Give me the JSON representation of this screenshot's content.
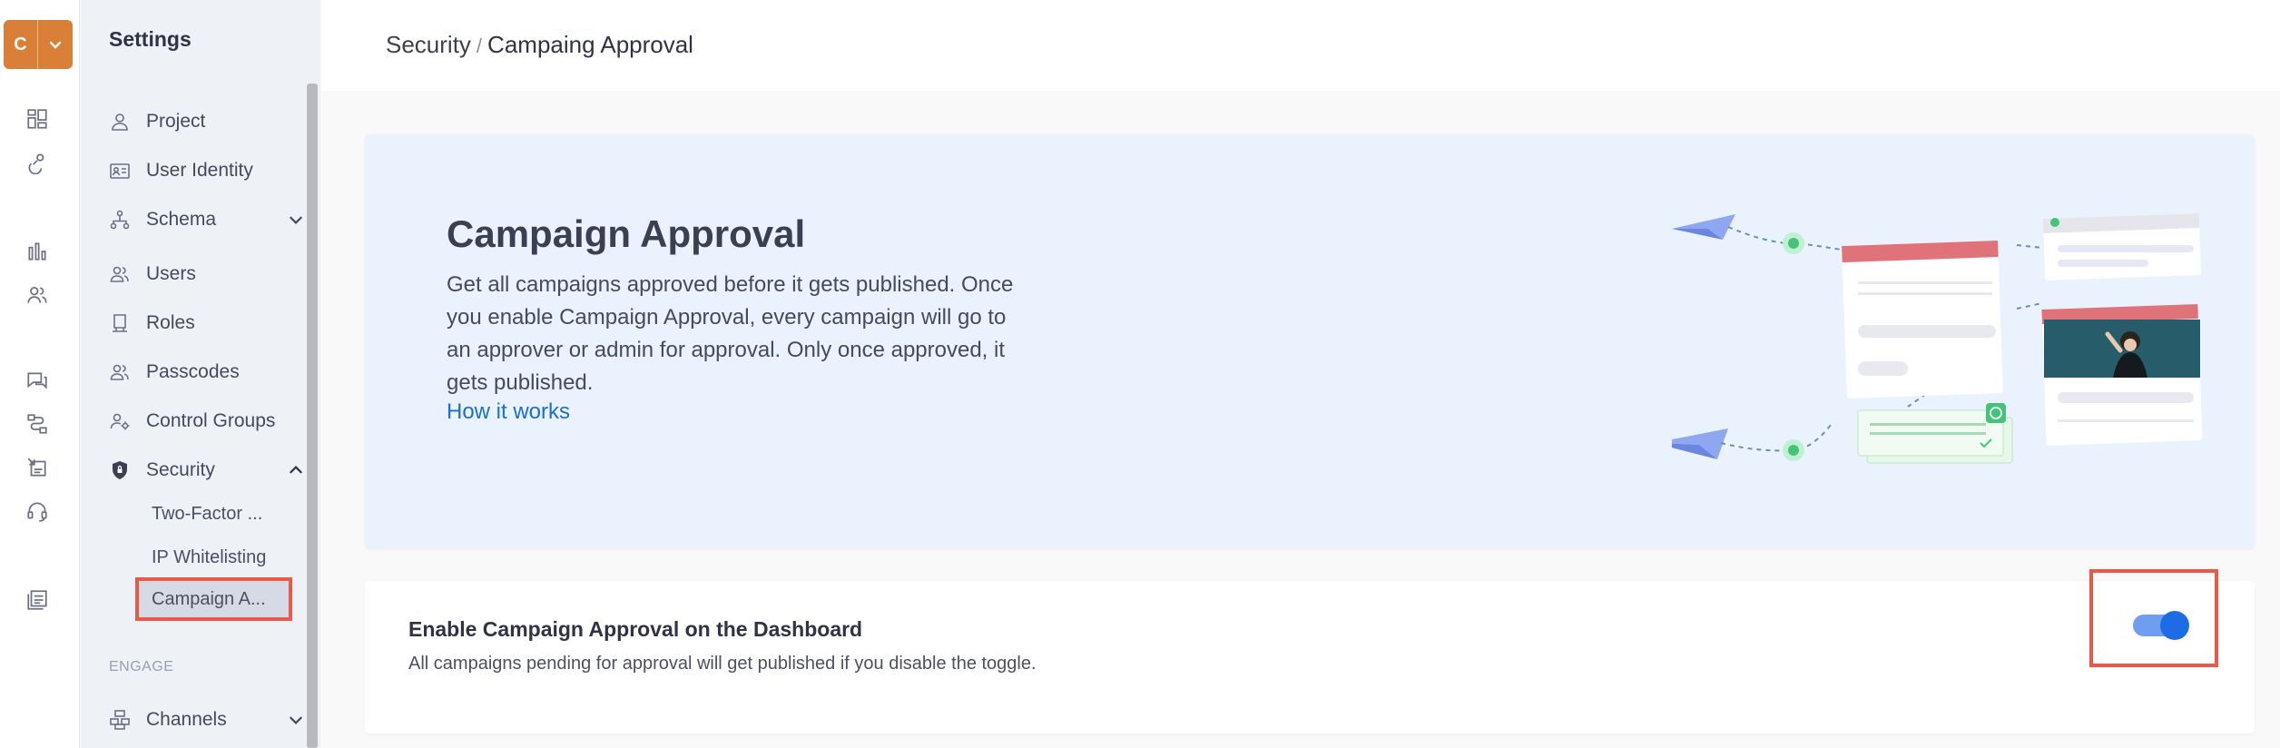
{
  "rail": {
    "project_letter": "C"
  },
  "sidebar": {
    "title": "Settings",
    "items": [
      {
        "label": "Project"
      },
      {
        "label": "User Identity"
      },
      {
        "label": "Schema"
      },
      {
        "label": "Users"
      },
      {
        "label": "Roles"
      },
      {
        "label": "Passcodes"
      },
      {
        "label": "Control Groups"
      },
      {
        "label": "Security"
      }
    ],
    "security_sub": [
      {
        "label": "Two-Factor ..."
      },
      {
        "label": "IP Whitelisting"
      },
      {
        "label": "Campaign A..."
      }
    ],
    "section_engage": "ENGAGE",
    "channels_label": "Channels"
  },
  "header": {
    "breadcrumb_parent": "Security",
    "breadcrumb_sep": "/",
    "breadcrumb_current": "Campaing Approval"
  },
  "banner": {
    "title": "Campaign Approval",
    "description": "Get all campaigns approved before it gets published. Once you enable Campaign Approval, every campaign will go to an approver or admin for approval. Only once approved, it gets published.",
    "link": "How it works"
  },
  "setting_card": {
    "title": "Enable Campaign Approval on the Dashboard",
    "description": "All campaigns pending for approval will get published if you disable the toggle.",
    "toggle_on": true
  },
  "colors": {
    "brand": "#d97f37",
    "accent": "#1e6be6",
    "highlight": "#e8594a"
  }
}
